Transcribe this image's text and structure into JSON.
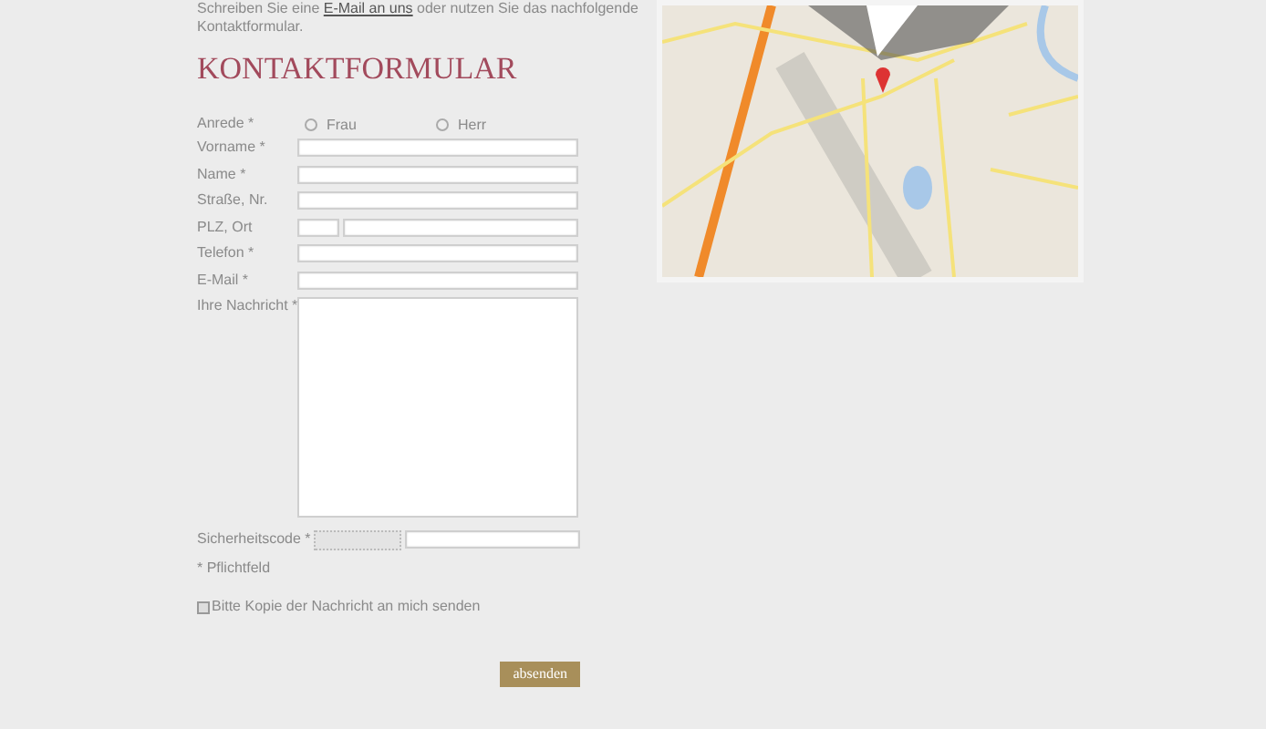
{
  "intro": {
    "before": "Schreiben Sie eine ",
    "link": "E-Mail an uns",
    "after": " oder nutzen Sie das nachfolgende",
    "line2": "Kontaktformular."
  },
  "heading": "KONTAKTFORMULAR",
  "fields": [
    {
      "kind": "radio",
      "label": "Anrede *",
      "options": [
        {
          "label": "Frau",
          "selected": false
        },
        {
          "label": "Herr",
          "selected": false
        }
      ]
    },
    {
      "kind": "text",
      "label": "Vorname *"
    },
    {
      "kind": "text",
      "label": "Name *"
    },
    {
      "kind": "text",
      "label": "Straße, Nr."
    },
    {
      "kind": "split",
      "label": "PLZ, Ort"
    },
    {
      "kind": "text",
      "label": "Telefon *"
    },
    {
      "kind": "text",
      "label": "E-Mail *"
    },
    {
      "kind": "textarea",
      "label": "Ihre Nachricht *"
    },
    {
      "kind": "captcha",
      "label": "Sicherheitscode *"
    }
  ],
  "required_note": "* Pflichtfeld",
  "copy_checkbox": {
    "label": "Bitte Kopie der Nachricht an mich senden",
    "checked": false
  },
  "submit": "absenden"
}
